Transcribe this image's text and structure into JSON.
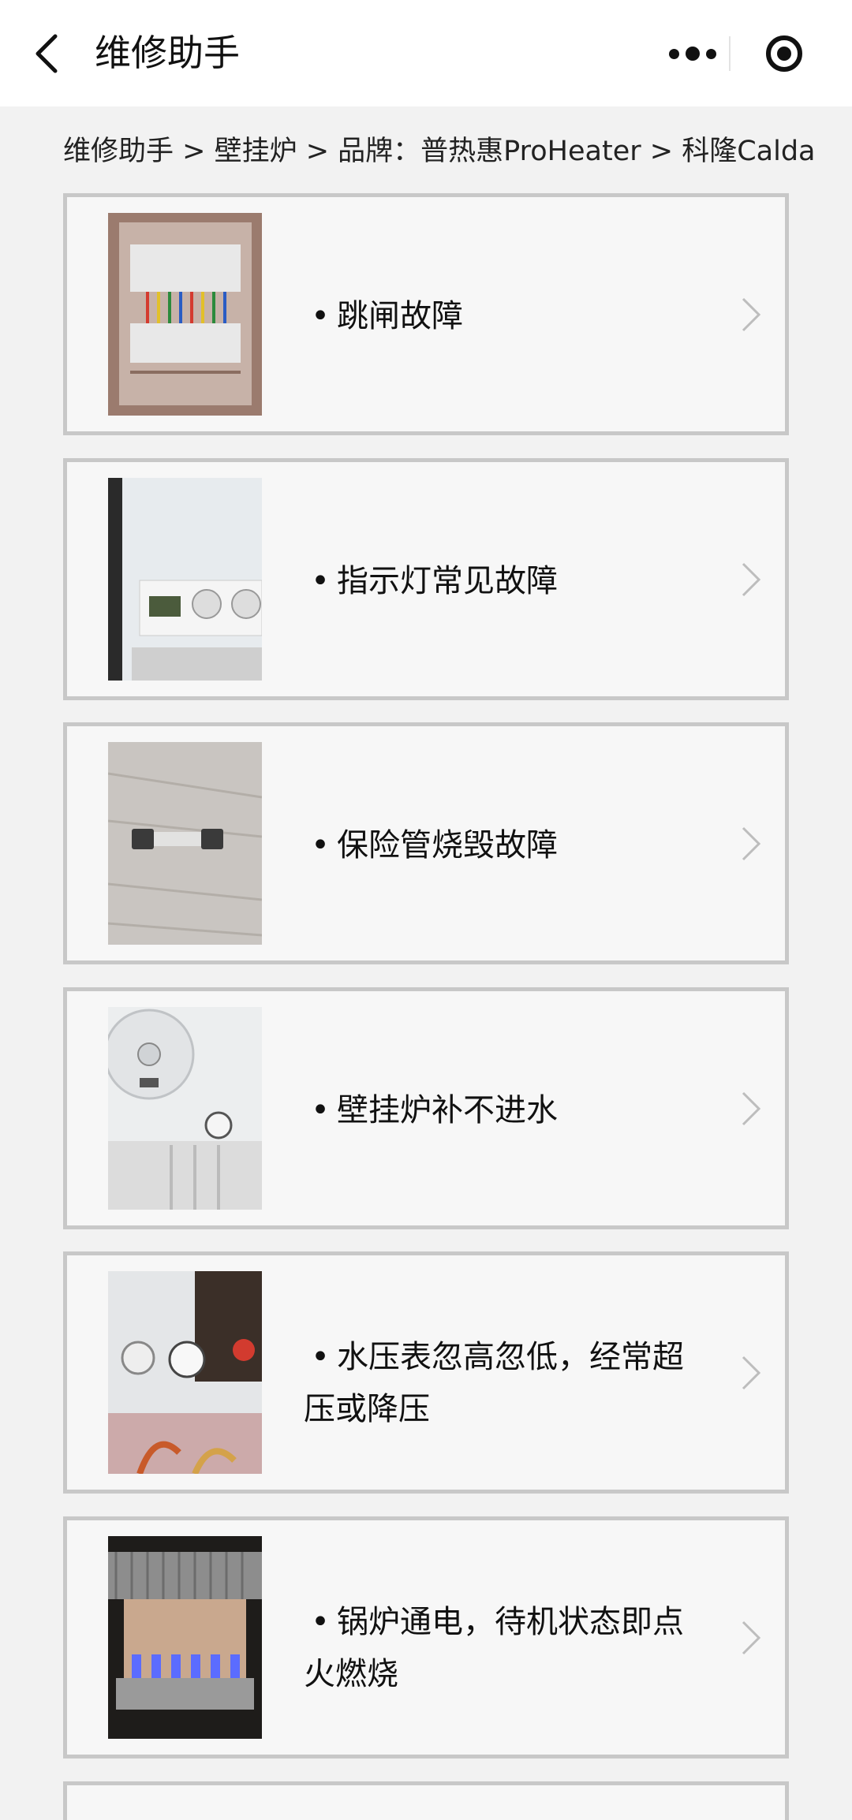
{
  "navbar": {
    "title": "维修助手",
    "back_icon": "chevron-left-icon",
    "more_icon": "more-dots-icon",
    "close_icon": "target-circle-icon"
  },
  "breadcrumb": "维修助手 > 壁挂炉 > 品牌：普热惠ProHeater > 科隆Calda",
  "items": [
    {
      "bullet": "•",
      "label": "跳闸故障"
    },
    {
      "bullet": "•",
      "label": "指示灯常见故障"
    },
    {
      "bullet": "•",
      "label": "保险管烧毁故障"
    },
    {
      "bullet": "•",
      "label": "壁挂炉补不进水"
    },
    {
      "bullet": "•",
      "label": "水压表忽高忽低，经常超",
      "label_line2": "压或降压"
    },
    {
      "bullet": "•",
      "label": "锅炉通电，待机状态即点",
      "label_line2": "火燃烧"
    }
  ],
  "colors": {
    "page_bg": "#f2f2f2",
    "card_bg": "#f7f7f7",
    "card_border": "#c8c8c8",
    "chevron": "#bdbdbd"
  }
}
